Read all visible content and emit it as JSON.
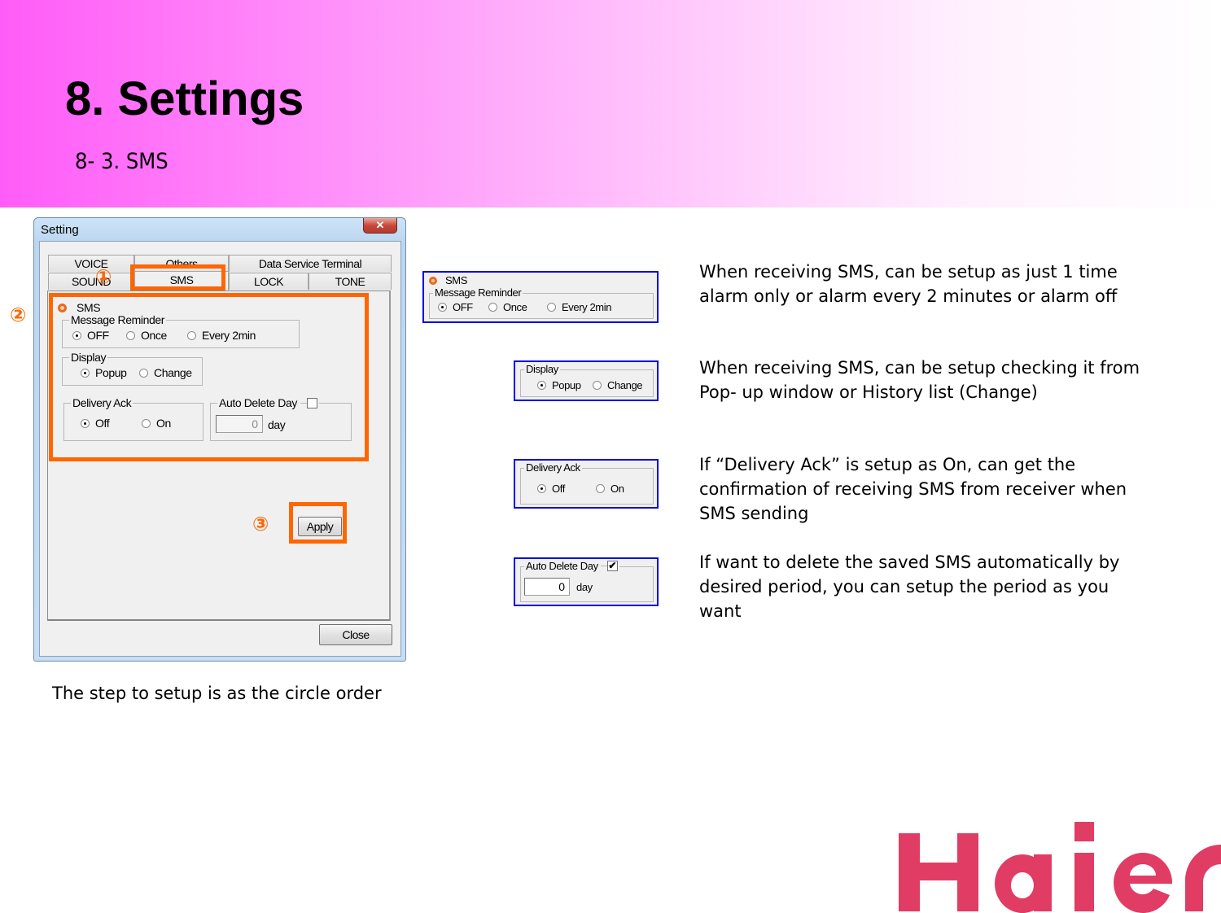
{
  "header": {
    "title": "8. Settings",
    "subtitle": "8- 3. SMS",
    "gradient_start": "#ff5cf7",
    "gradient_end": "#ffffff"
  },
  "dialog": {
    "title": "Setting",
    "close_icon": "close-x-icon",
    "tabs_row1": [
      "VOICE",
      "Others",
      "Data Service Terminal"
    ],
    "tabs_row2": [
      "SOUND",
      "SMS",
      "LOCK",
      "TONE"
    ],
    "active_tab": "SMS",
    "section_label": "SMS",
    "section_icon": "sms-bullet-icon",
    "message_reminder": {
      "legend": "Message Reminder",
      "options": [
        "OFF",
        "Once",
        "Every 2min"
      ],
      "selected": "OFF"
    },
    "display": {
      "legend": "Display",
      "options": [
        "Popup",
        "Change"
      ],
      "selected": "Popup"
    },
    "delivery_ack": {
      "legend": "Delivery Ack",
      "options": [
        "Off",
        "On"
      ],
      "selected": "Off"
    },
    "auto_delete": {
      "legend": "Auto Delete Day",
      "checked": false,
      "value": "0",
      "unit": "day"
    },
    "apply_label": "Apply",
    "close_label": "Close"
  },
  "markers": {
    "step1": "①",
    "step2": "②",
    "step3": "③",
    "highlight_color": "#ff6600"
  },
  "callouts": {
    "border_color": "#0000e0",
    "sms": {
      "label": "SMS",
      "legend": "Message Reminder",
      "options": [
        "OFF",
        "Once",
        "Every 2min"
      ],
      "selected": "OFF"
    },
    "display": {
      "legend": "Display",
      "options": [
        "Popup",
        "Change"
      ],
      "selected": "Popup"
    },
    "delivery_ack": {
      "legend": "Delivery Ack",
      "options": [
        "Off",
        "On"
      ],
      "selected": "Off"
    },
    "auto_delete": {
      "legend": "Auto Delete Day",
      "checked": true,
      "check_mark": "✔",
      "value": "0",
      "unit": "day"
    }
  },
  "descriptions": [
    "When receiving SMS, can be setup as just 1 time alarm only or alarm every 2 minutes or alarm off",
    "When receiving SMS, can be setup checking it from Pop- up window or History list (Change)",
    "If “Delivery Ack” is setup as On, can get the confirmation of receiving SMS from receiver when SMS sending",
    "If want to delete the saved SMS automatically by desired period, you can setup the period as you want"
  ],
  "footnote": "The step to setup is as the circle order",
  "logo": {
    "text": "Haier",
    "color": "#e03c64"
  }
}
